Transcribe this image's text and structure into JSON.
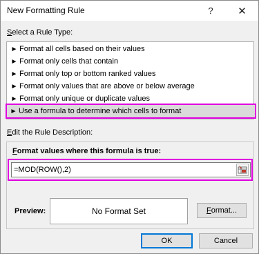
{
  "window": {
    "title": "New Formatting Rule",
    "help_label": "?",
    "close_label": "✕"
  },
  "rule_type": {
    "label_prefix": "S",
    "label_rest": "elect a Rule Type:",
    "arrow_glyph": "►",
    "items": [
      {
        "label": "Format all cells based on their values",
        "selected": false
      },
      {
        "label": "Format only cells that contain",
        "selected": false
      },
      {
        "label": "Format only top or bottom ranked values",
        "selected": false
      },
      {
        "label": "Format only values that are above or below average",
        "selected": false
      },
      {
        "label": "Format only unique or duplicate values",
        "selected": false
      },
      {
        "label": "Use a formula to determine which cells to format",
        "selected": true
      }
    ]
  },
  "description": {
    "label_prefix": "E",
    "label_rest": "dit the Rule Description:",
    "formula_label_prefix": "F",
    "formula_label_rest": "ormat values where this formula is true:",
    "formula_value": "=MOD(ROW(),2)"
  },
  "preview": {
    "label": "Preview:",
    "text": "No Format Set"
  },
  "buttons": {
    "format_prefix": "F",
    "format_rest": "ormat...",
    "ok": "OK",
    "cancel": "Cancel"
  },
  "colors": {
    "highlight_border": "#e000e0",
    "selected_row": "#dadada",
    "default_button_border": "#0078d7"
  }
}
